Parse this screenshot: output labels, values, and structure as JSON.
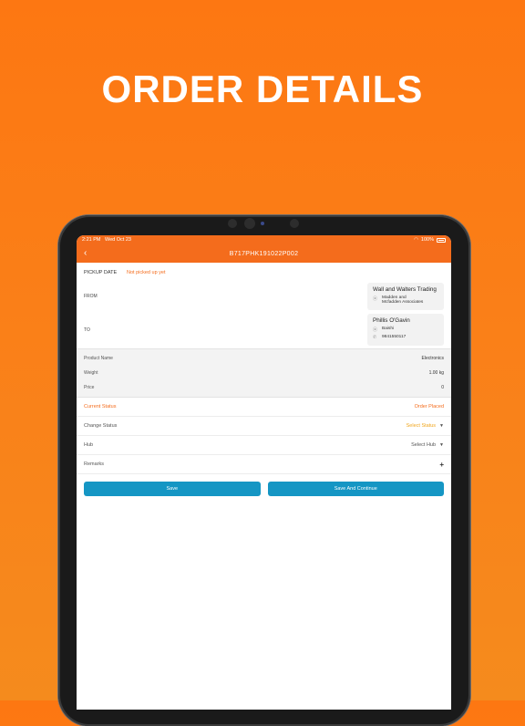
{
  "headline": "ORDER DETAILS",
  "status_bar": {
    "time": "2:21 PM",
    "date": "Wed Oct 23",
    "battery": "100%"
  },
  "nav": {
    "title": "B717PHK191022P002",
    "back_glyph": "‹"
  },
  "pickup": {
    "label": "PICKUP DATE",
    "value": "Not picked up yet"
  },
  "from": {
    "label": "FROM",
    "name": "Wall and Walters Trading",
    "address": "Madden and\nMcfadden Associates"
  },
  "to": {
    "label": "TO",
    "name": "Phillis O'Gavin",
    "address": "Baishi",
    "phone": "9841550117"
  },
  "product": [
    {
      "label": "Product Name",
      "value": "Electronics"
    },
    {
      "label": "Weight",
      "value": "1.00 kg"
    },
    {
      "label": "Price",
      "value": "0"
    }
  ],
  "current_status": {
    "label": "Current Status",
    "value": "Order Placed"
  },
  "change_status": {
    "label": "Change Status",
    "value": "Select Status"
  },
  "hub": {
    "label": "Hub",
    "value": "Select Hub"
  },
  "remarks": {
    "label": "Remarks",
    "action": "+"
  },
  "buttons": {
    "save": "Save",
    "save_continue": "Save And Continue"
  },
  "colors": {
    "brand": "#f46c1c",
    "button": "#1596c4",
    "background": "#fd7712"
  }
}
